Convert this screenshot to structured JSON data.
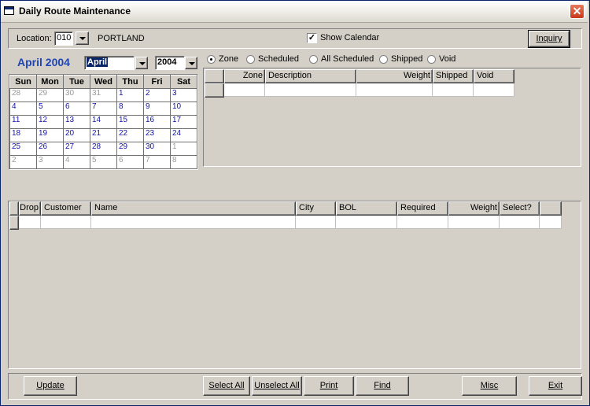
{
  "window": {
    "title": "Daily Route Maintenance"
  },
  "location": {
    "label": "Location:",
    "code": "010",
    "name": "PORTLAND"
  },
  "show_calendar": {
    "label": "Show Calendar",
    "checked": true
  },
  "inquiry": {
    "label": "Inquiry"
  },
  "calendar": {
    "title": "April 2004",
    "month": "April",
    "year": "2004",
    "weekdays": [
      "Sun",
      "Mon",
      "Tue",
      "Wed",
      "Thu",
      "Fri",
      "Sat"
    ],
    "weeks": [
      [
        "28",
        "29",
        "30",
        "31",
        "1",
        "2",
        "3"
      ],
      [
        "4",
        "5",
        "6",
        "7",
        "8",
        "9",
        "10"
      ],
      [
        "11",
        "12",
        "13",
        "14",
        "15",
        "16",
        "17"
      ],
      [
        "18",
        "19",
        "20",
        "21",
        "22",
        "23",
        "24"
      ],
      [
        "25",
        "26",
        "27",
        "28",
        "29",
        "30",
        "1"
      ],
      [
        "2",
        "3",
        "4",
        "5",
        "6",
        "7",
        "8"
      ]
    ]
  },
  "filters": [
    {
      "label": "Zone",
      "selected": true
    },
    {
      "label": "Scheduled",
      "selected": false
    },
    {
      "label": "All Scheduled",
      "selected": false
    },
    {
      "label": "Shipped",
      "selected": false
    },
    {
      "label": "Void",
      "selected": false
    }
  ],
  "zone_grid": {
    "columns": [
      "Zone",
      "Description",
      "Weight",
      "Shipped",
      "Void"
    ]
  },
  "order_grid": {
    "columns": [
      "Drop",
      "Customer",
      "Name",
      "City",
      "BOL",
      "Required",
      "Weight",
      "Select?"
    ]
  },
  "buttons": {
    "update": "Update",
    "select_all": "Select All",
    "unselect_all": "Unselect All",
    "print": "Print",
    "find": "Find",
    "misc": "Misc",
    "exit": "Exit"
  }
}
